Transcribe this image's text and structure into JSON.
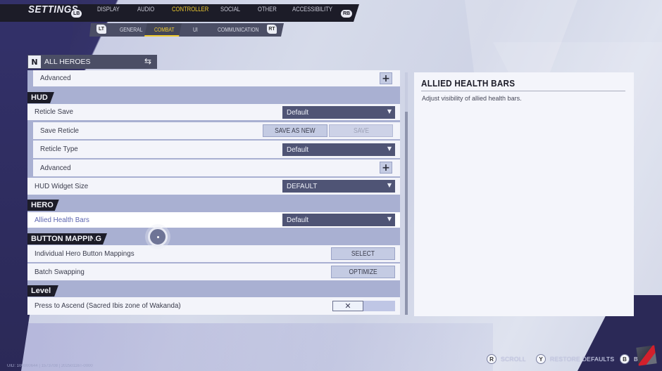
{
  "header": {
    "title": "SETTINGS",
    "left_bumper": "LB",
    "right_bumper": "RB",
    "tabs": [
      {
        "label": "DISPLAY",
        "active": false
      },
      {
        "label": "AUDIO",
        "active": false
      },
      {
        "label": "CONTROLLER",
        "active": true
      },
      {
        "label": "SOCIAL",
        "active": false
      },
      {
        "label": "OTHER",
        "active": false
      },
      {
        "label": "ACCESSIBILITY",
        "active": false
      }
    ],
    "left_trigger": "LT",
    "right_trigger": "RT",
    "subtabs": [
      {
        "label": "GENERAL",
        "active": false
      },
      {
        "label": "COMBAT",
        "active": true
      },
      {
        "label": "UI",
        "active": false
      },
      {
        "label": "COMMUNICATION",
        "active": false
      }
    ]
  },
  "hero_selector": {
    "label": "ALL HEROES",
    "icon": "N",
    "swap_icon": "⇆"
  },
  "list": {
    "rows": {
      "advanced_top": {
        "label": "Advanced",
        "control": "+"
      },
      "reticle_save": {
        "label": "Reticle Save",
        "value": "Default"
      },
      "save_reticle": {
        "label": "Save Reticle",
        "save_as_new": "SAVE AS NEW",
        "save": "SAVE"
      },
      "reticle_type": {
        "label": "Reticle Type",
        "value": "Default"
      },
      "advanced_hud": {
        "label": "Advanced",
        "control": "+"
      },
      "hud_widget_size": {
        "label": "HUD Widget Size",
        "value": "DEFAULT"
      },
      "allied_health_bars": {
        "label": "Allied Health Bars",
        "value": "Default"
      },
      "individual_mappings": {
        "label": "Individual Hero Button Mappings",
        "button": "SELECT"
      },
      "batch_swapping": {
        "label": "Batch Swapping",
        "button": "OPTIMIZE"
      },
      "press_to_ascend": {
        "label": "Press to Ascend (Sacred Ibis zone of Wakanda)",
        "toggle_icon": "✕",
        "enabled": false
      }
    },
    "sections": {
      "hud": "HUD",
      "hero": "HERO",
      "button_mapping": "BUTTON MAPPING",
      "level": "Level"
    },
    "caret": "▼"
  },
  "detail": {
    "title": "ALLIED HEALTH BARS",
    "description": "Adjust visibility of allied health bars."
  },
  "footer": {
    "hints": [
      {
        "button": "R",
        "label": "SCROLL"
      },
      {
        "button": "Y",
        "label": "RESTORE DEFAULTS"
      },
      {
        "button": "B",
        "label": "BACK"
      }
    ],
    "uid": "UID: 100000644 | 1573708 | 20250116T-0000"
  }
}
